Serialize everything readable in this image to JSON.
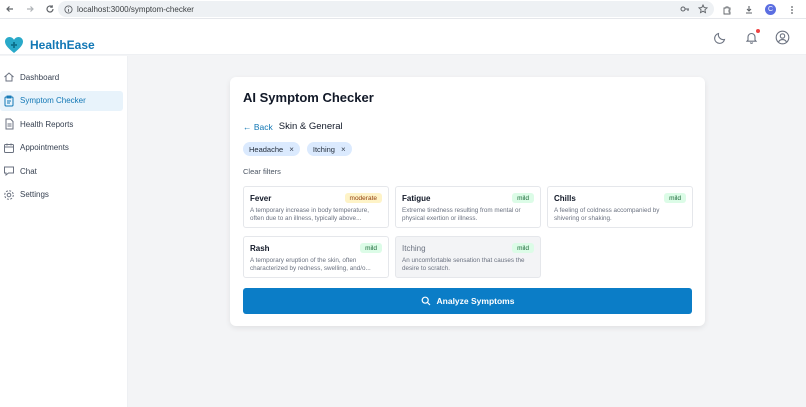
{
  "browser": {
    "url": "localhost:3000/symptom-checker",
    "profile_initial": "C"
  },
  "app": {
    "name": "HealthEase",
    "brand_color": "#1177b5"
  },
  "sidebar": {
    "items": [
      {
        "label": "Dashboard",
        "icon": "home-icon",
        "active": false
      },
      {
        "label": "Symptom Checker",
        "icon": "clipboard-icon",
        "active": true
      },
      {
        "label": "Health Reports",
        "icon": "report-icon",
        "active": false
      },
      {
        "label": "Appointments",
        "icon": "calendar-icon",
        "active": false
      },
      {
        "label": "Chat",
        "icon": "chat-icon",
        "active": false
      },
      {
        "label": "Settings",
        "icon": "gear-icon",
        "active": false
      }
    ]
  },
  "checker": {
    "title": "AI Symptom Checker",
    "back_label": "← Back",
    "category": "Skin & General",
    "selected_chips": [
      "Headache",
      "Itching"
    ],
    "clear_filters": "Clear filters",
    "symptoms": [
      {
        "name": "Fever",
        "severity": "moderate",
        "desc": "A temporary increase in body temperature, often due to an illness, typically above...",
        "selected": false
      },
      {
        "name": "Fatigue",
        "severity": "mild",
        "desc": "Extreme tiredness resulting from mental or physical exertion or illness.",
        "selected": false
      },
      {
        "name": "Chills",
        "severity": "mild",
        "desc": "A feeling of coldness accompanied by shivering or shaking.",
        "selected": false
      },
      {
        "name": "Rash",
        "severity": "mild",
        "desc": "A temporary eruption of the skin, often characterized by redness, swelling, and/o...",
        "selected": false
      },
      {
        "name": "Itching",
        "severity": "mild",
        "desc": "An uncomfortable sensation that causes the desire to scratch.",
        "selected": true
      }
    ],
    "analyze_label": "Analyze Symptoms",
    "button_color": "#0b7dc7"
  }
}
